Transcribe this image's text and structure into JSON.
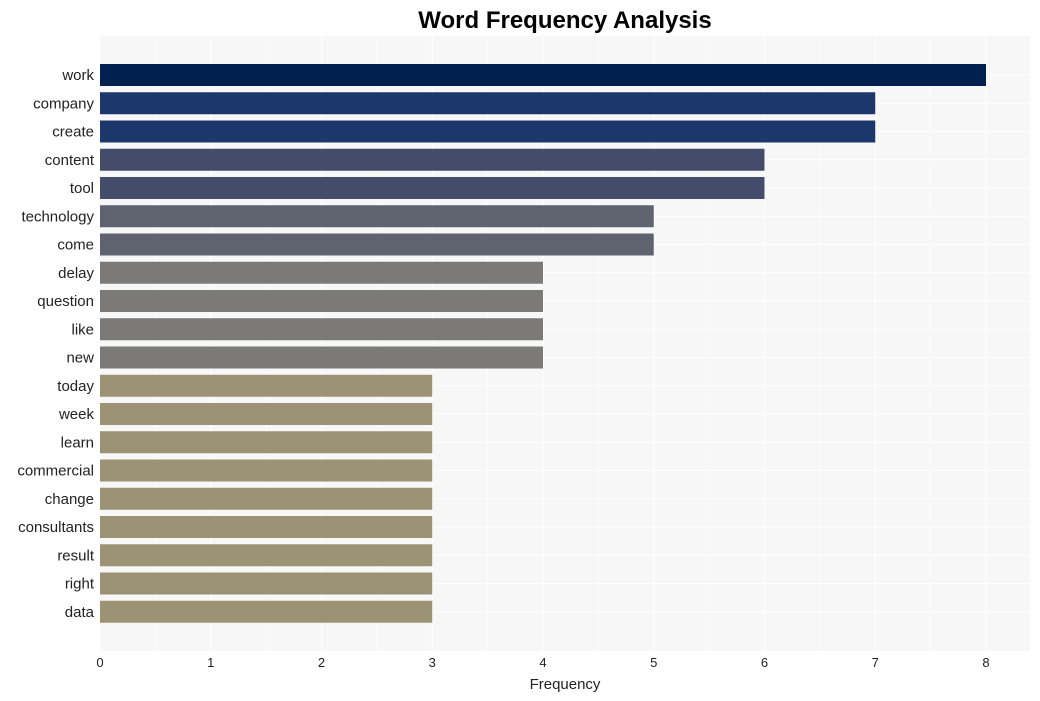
{
  "chart_data": {
    "type": "bar",
    "orientation": "horizontal",
    "title": "Word Frequency Analysis",
    "xlabel": "Frequency",
    "ylabel": "",
    "xlim": [
      0,
      8.4
    ],
    "xticks": [
      0,
      1,
      2,
      3,
      4,
      5,
      6,
      7,
      8
    ],
    "grid": true,
    "categories": [
      "work",
      "company",
      "create",
      "content",
      "tool",
      "technology",
      "come",
      "delay",
      "question",
      "like",
      "new",
      "today",
      "week",
      "learn",
      "commercial",
      "change",
      "consultants",
      "result",
      "right",
      "data"
    ],
    "values": [
      8,
      7,
      7,
      6,
      6,
      5,
      5,
      4,
      4,
      4,
      4,
      3,
      3,
      3,
      3,
      3,
      3,
      3,
      3,
      3
    ],
    "colors_by_value": {
      "8": "#00204f",
      "7": "#1b376c",
      "6": "#434c6a",
      "5": "#5f636f",
      "4": "#7b7a77",
      "3": "#9b9374"
    },
    "background": "#f7f7f8",
    "gridline_color": "#ffffff"
  }
}
